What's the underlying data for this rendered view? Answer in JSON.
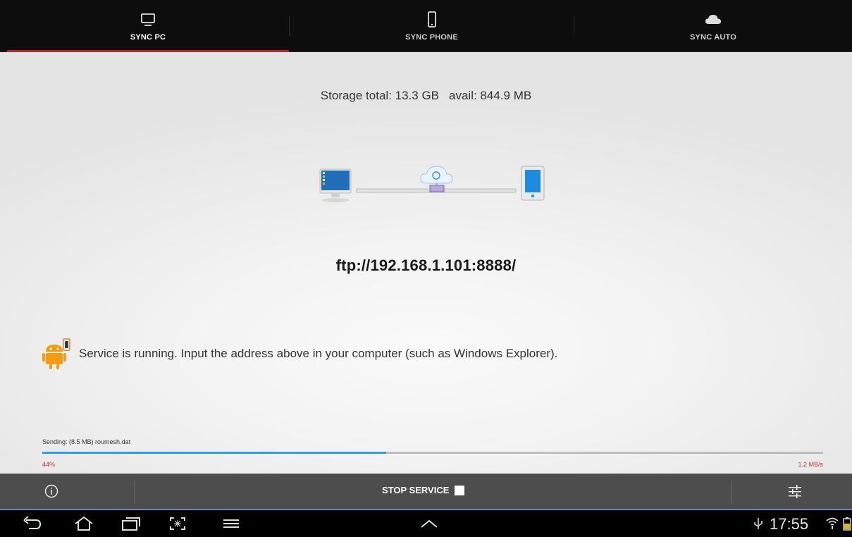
{
  "tabs": [
    {
      "label": "SYNC PC",
      "icon": "monitor-icon",
      "active": true
    },
    {
      "label": "SYNC PHONE",
      "icon": "phone-icon",
      "active": false
    },
    {
      "label": "SYNC AUTO",
      "icon": "cloud-icon",
      "active": false
    }
  ],
  "storage": {
    "total": "Storage total: 13.3 GB",
    "avail": "avail: 844.9 MB"
  },
  "ftp_address": "ftp://192.168.1.101:8888/",
  "service_message": "Service is running. Input the address above in your computer (such as Windows Explorer).",
  "transfer": {
    "sending_text": "Sending: (8.5 MB) roumesh.dat",
    "percent_label": "44%",
    "progress": 0.44,
    "speed": "1.2 MB/s"
  },
  "actionbar": {
    "stop_label": "STOP SERVICE",
    "info_icon": "info-icon",
    "settings_icon": "sliders-icon"
  },
  "statusbar": {
    "time": "17:55"
  },
  "colors": {
    "accent_red": "#c8202a",
    "progress_blue": "#2aa1e6",
    "alert_red": "#c0392b",
    "actionbar_bg": "#4d4d4d"
  }
}
